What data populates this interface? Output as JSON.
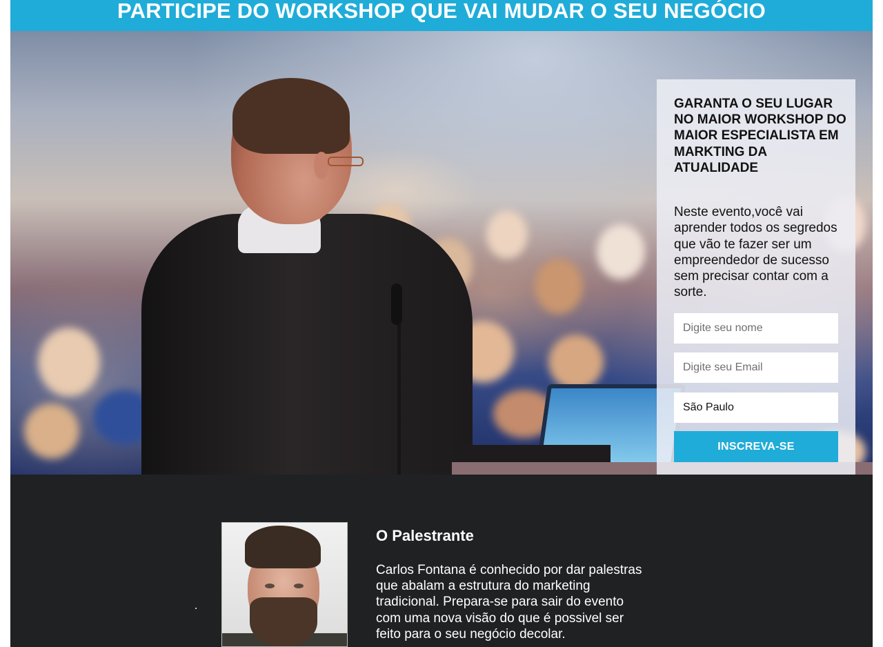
{
  "banner": {
    "title": "PARTICIPE DO WORKSHOP QUE VAI MUDAR O SEU NEGÓCIO"
  },
  "signup": {
    "title": "GARANTA O SEU LUGAR NO MAIOR WORKSHOP DO MAIOR ESPECIALISTA EM MARKTING DA ATUALIDADE",
    "description": "Neste evento,você vai aprender todos os segredos que vão te fazer ser um empreendedor de sucesso sem precisar contar com a sorte.",
    "name_placeholder": "Digite seu nome",
    "email_placeholder": "Digite seu Email",
    "city_value": "São Paulo",
    "submit_label": "INSCREVA-SE"
  },
  "speaker": {
    "heading": "O Palestrante",
    "bio": "Carlos Fontana é conhecido por dar palestras que abalam a estrutura do marketing tradicional. Prepara-se para sair do evento com uma nova visão do que é possivel ser feito para o seu negócio decolar."
  },
  "colors": {
    "accent": "#20acd8",
    "dark_section": "#1f2122",
    "card_background": "#eceef4"
  }
}
